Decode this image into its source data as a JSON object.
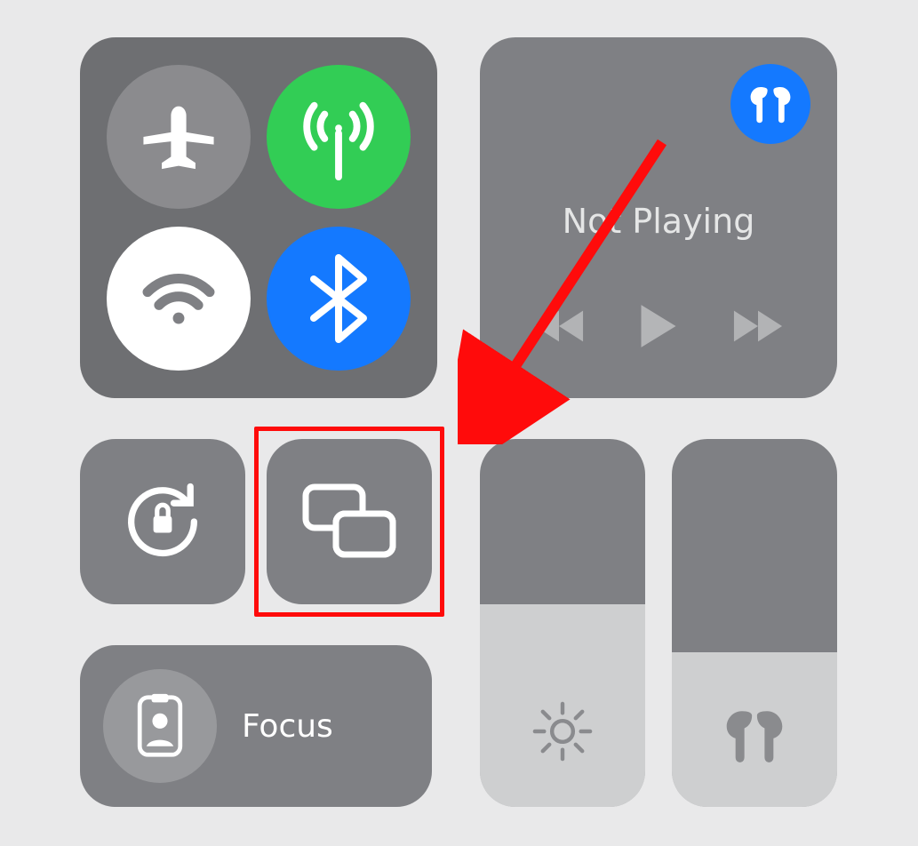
{
  "connectivity": {
    "airplane": {
      "icon": "airplane-icon",
      "active": false
    },
    "cellular": {
      "icon": "cellular-antenna-icon",
      "active": true,
      "color": "#32cd55"
    },
    "wifi": {
      "icon": "wifi-icon",
      "active": true,
      "color": "#ffffff"
    },
    "bluetooth": {
      "icon": "bluetooth-icon",
      "active": true,
      "color": "#1479ff"
    }
  },
  "media": {
    "status": "Not Playing",
    "airpods_connected": true
  },
  "controls": {
    "orientation_lock": {
      "icon": "orientation-lock-icon"
    },
    "screen_mirroring": {
      "icon": "screen-mirroring-icon",
      "highlighted": true
    }
  },
  "sliders": {
    "brightness": {
      "percent": 55,
      "icon": "brightness-icon"
    },
    "volume": {
      "percent": 42,
      "icon": "airpods-icon"
    }
  },
  "focus": {
    "label": "Focus",
    "icon": "focus-badge-icon"
  },
  "annotation": {
    "type": "arrow",
    "color": "#ff0b0b",
    "from": "media-panel",
    "to": "screen-mirroring-button"
  }
}
